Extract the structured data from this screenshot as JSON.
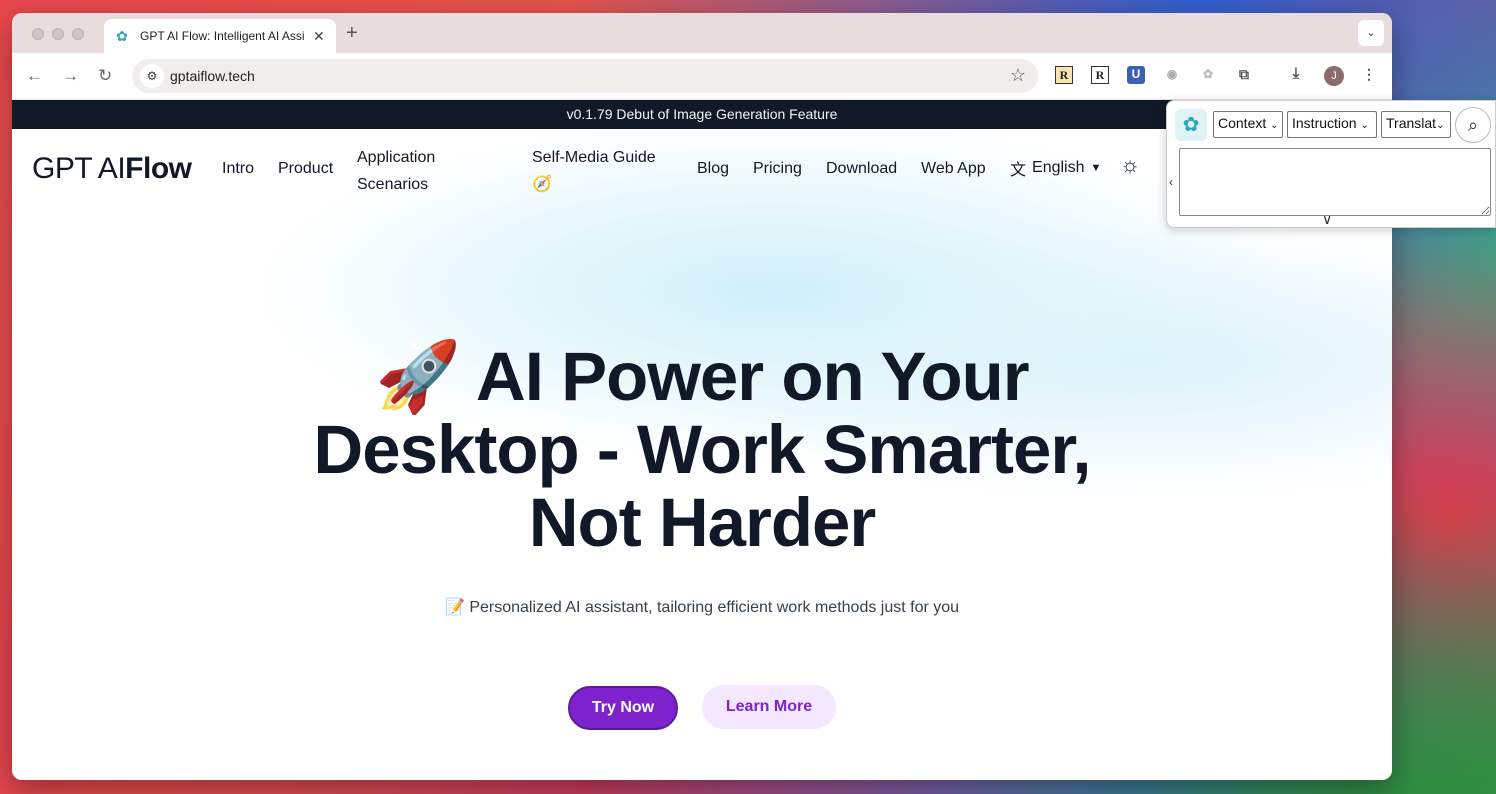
{
  "browser": {
    "tab_title": "GPT AI Flow: Intelligent AI Assistant",
    "tab_close": "✕",
    "new_tab": "+",
    "tab_search": "⌄",
    "url": "gptaiflow.tech",
    "extensions": [
      "R",
      "R",
      "U"
    ],
    "profile_initial": "J"
  },
  "page": {
    "banner": "v0.1.79 Debut of Image Generation Feature",
    "logo_light": "GPT AI",
    "logo_bold": "Flow",
    "nav": {
      "intro": "Intro",
      "product": "Product",
      "application_scenarios": "Application Scenarios",
      "self_media_guide": "Self-Media Guide 🧭",
      "blog": "Blog",
      "pricing": "Pricing",
      "download": "Download",
      "web_app": "Web App",
      "language": "English"
    },
    "hero_title": "🚀 AI Power on Your Desktop - Work Smarter, Not Harder",
    "hero_subtitle": "📝 Personalized AI assistant, tailoring efficient work methods just for you",
    "try_now": "Try Now",
    "learn_more": "Learn More"
  },
  "popup": {
    "select_context": "Context",
    "select_instruction": "Instruction",
    "select_translate": "Translat"
  },
  "colors": {
    "accent": "#7e22ce",
    "accent_light": "#f3e8ff",
    "banner_bg": "#111827"
  }
}
